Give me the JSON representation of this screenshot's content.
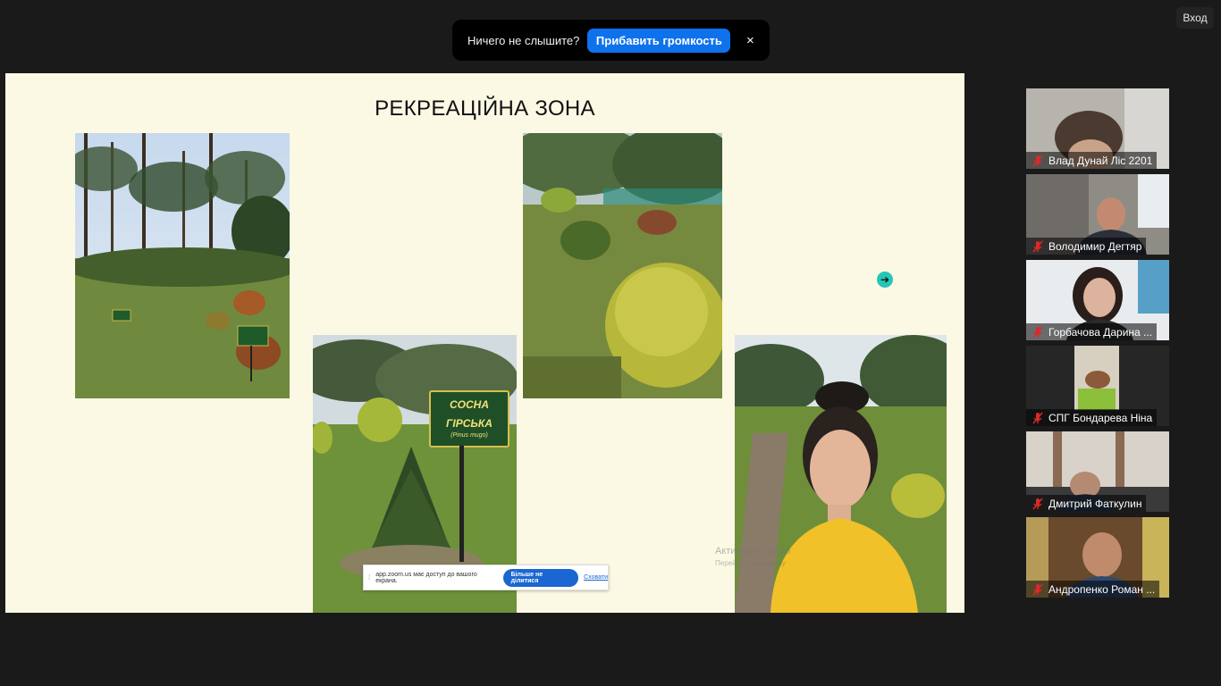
{
  "top_right": {
    "login_label": "Вход"
  },
  "audio_banner": {
    "message": "Ничего не слышите?",
    "button_label": "Прибавить громкость",
    "close_glyph": "×"
  },
  "slide": {
    "title": "РЕКРЕАЦІЙНА ЗОНА",
    "sign_line1": "СОСНА",
    "sign_line2": "ГІРСЬКА",
    "sign_latin": "(Pinus mugo)",
    "nav_arrow_glyph": "➔",
    "watermark_line1": "Активація Windo",
    "watermark_line2": "Перейдіть до розділу"
  },
  "share_bar": {
    "grip_glyph": "⁞",
    "message": "app.zoom.us має доступ до вашого екрана.",
    "stop_label": "Більше не ділитися",
    "hide_label": "Сховати"
  },
  "participants": [
    {
      "name": "Влад Дунай Ліс 2201",
      "muted": true
    },
    {
      "name": "Володимир Дегтяр",
      "muted": true
    },
    {
      "name": "Горбачова Дарина ...",
      "muted": true
    },
    {
      "name": "СПГ Бондарева Ніна",
      "muted": true
    },
    {
      "name": "Дмитрий Фаткулин",
      "muted": true
    },
    {
      "name": "Андропенко Роман ...",
      "muted": true
    }
  ],
  "colors": {
    "accent": "#0e72ed",
    "slide_bg": "#fbf9e4",
    "muted_mic": "#e02828"
  }
}
